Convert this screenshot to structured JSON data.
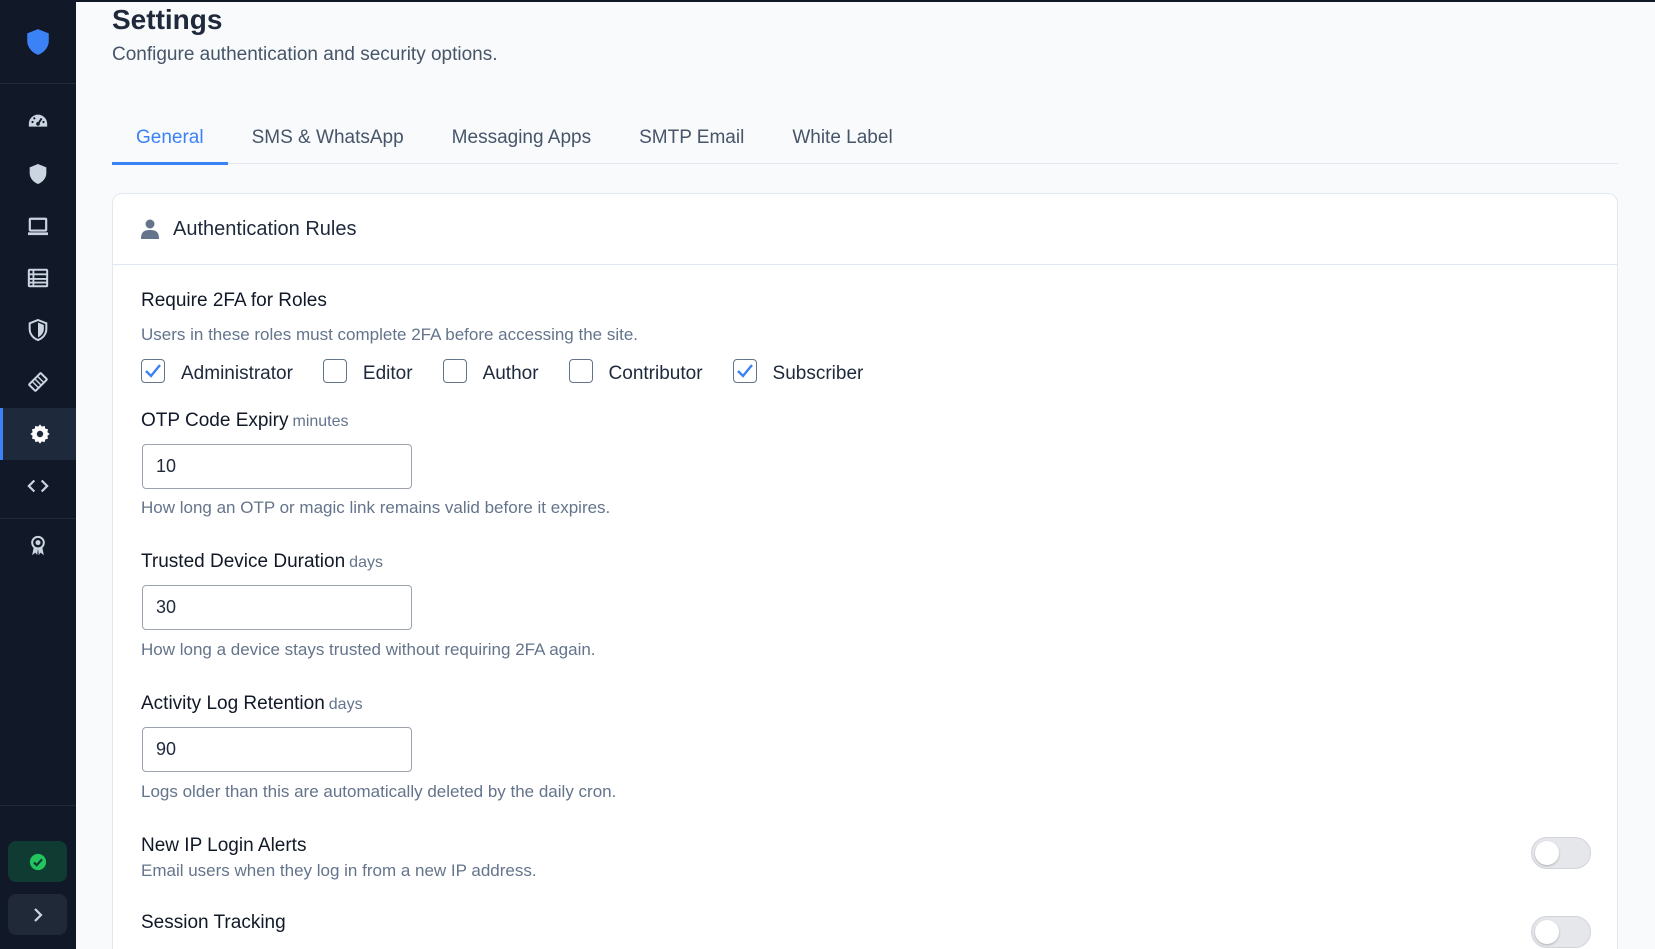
{
  "header": {
    "title": "Settings",
    "subtitle": "Configure authentication and security options."
  },
  "tabs": [
    {
      "label": "General",
      "active": true
    },
    {
      "label": "SMS & WhatsApp",
      "active": false
    },
    {
      "label": "Messaging Apps",
      "active": false
    },
    {
      "label": "SMTP Email",
      "active": false
    },
    {
      "label": "White Label",
      "active": false
    }
  ],
  "sidebar": {
    "items": [
      {
        "icon": "dashboard-icon"
      },
      {
        "icon": "shield-icon"
      },
      {
        "icon": "laptop-icon"
      },
      {
        "icon": "list-icon"
      },
      {
        "icon": "shield-half-icon"
      },
      {
        "icon": "ticket-icon"
      },
      {
        "icon": "gear-icon",
        "active": true
      },
      {
        "icon": "code-icon"
      },
      {
        "icon": "award-icon"
      }
    ],
    "status_icon": "check-circle-icon",
    "expand_icon": "chevron-right-icon"
  },
  "card": {
    "title": "Authentication Rules",
    "icon": "user-icon",
    "require_2fa": {
      "label": "Require 2FA for Roles",
      "help": "Users in these roles must complete 2FA before accessing the site.",
      "roles": [
        {
          "label": "Administrator",
          "checked": true
        },
        {
          "label": "Editor",
          "checked": false
        },
        {
          "label": "Author",
          "checked": false
        },
        {
          "label": "Contributor",
          "checked": false
        },
        {
          "label": "Subscriber",
          "checked": true
        }
      ]
    },
    "otp_expiry": {
      "label": "OTP Code Expiry",
      "unit": "minutes",
      "value": "10",
      "help": "How long an OTP or magic link remains valid before it expires."
    },
    "trusted_device": {
      "label": "Trusted Device Duration",
      "unit": "days",
      "value": "30",
      "help": "How long a device stays trusted without requiring 2FA again."
    },
    "log_retention": {
      "label": "Activity Log Retention",
      "unit": "days",
      "value": "90",
      "help": "Logs older than this are automatically deleted by the daily cron."
    },
    "ip_alerts": {
      "label": "New IP Login Alerts",
      "help": "Email users when they log in from a new IP address.",
      "enabled": false
    },
    "session_tracking": {
      "label": "Session Tracking",
      "enabled": false
    }
  },
  "colors": {
    "accent": "#3b82f6",
    "sidebar_bg": "#111827",
    "success": "#22c55e"
  }
}
